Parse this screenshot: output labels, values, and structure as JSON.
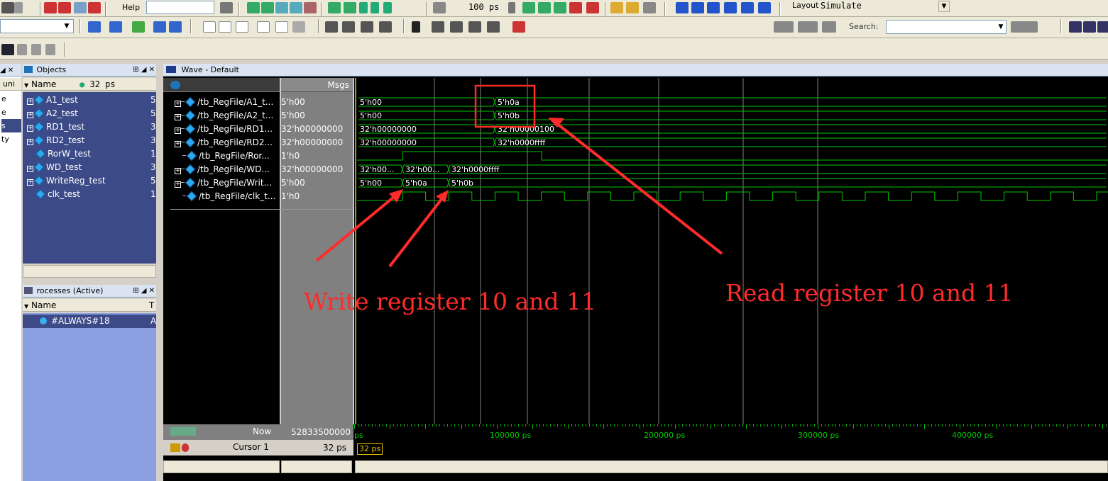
{
  "toolbar": {
    "help_label": "Help",
    "time_value": "100 ps",
    "layout_label": "Layout",
    "layout_value": "Simulate",
    "search_label": "Search:"
  },
  "objects_pane": {
    "title": "Objects",
    "col_name": "Name",
    "time_label": "32 ps",
    "items": [
      "A1_test",
      "A2_test",
      "RD1_test",
      "RD2_test",
      "RorW_test",
      "WD_test",
      "WriteReg_test",
      "clk_test"
    ],
    "right_col": [
      "5",
      "5",
      "3",
      "3",
      "1",
      "3",
      "5",
      "1"
    ]
  },
  "left_strip": {
    "header": "uni",
    "items": [
      "e",
      "e",
      "s",
      "ty"
    ]
  },
  "processes_pane": {
    "title": "rocesses (Active)",
    "col_name": "Name",
    "col_t": "T",
    "items": [
      "#ALWAYS#18"
    ],
    "right_col": [
      "A"
    ]
  },
  "wave": {
    "title": "Wave - Default",
    "msgs_header": "Msgs",
    "signals": [
      {
        "name": "/tb_RegFile/A1_t...",
        "value": "5'h00"
      },
      {
        "name": "/tb_RegFile/A2_t...",
        "value": "5'h00"
      },
      {
        "name": "/tb_RegFile/RD1...",
        "value": "32'h00000000"
      },
      {
        "name": "/tb_RegFile/RD2...",
        "value": "32'h00000000"
      },
      {
        "name": "/tb_RegFile/Ror...",
        "value": "1'h0"
      },
      {
        "name": "/tb_RegFile/WD...",
        "value": "32'h00000000"
      },
      {
        "name": "/tb_RegFile/Writ...",
        "value": "5'h00"
      },
      {
        "name": "/tb_RegFile/clk_t...",
        "value": "1'h0"
      }
    ],
    "bus_labels": {
      "a1_before": "5'h00",
      "a1_after": "5'h0a",
      "a2_before": "5'h00",
      "a2_after": "5'h0b",
      "rd1_before": "32'h00000000",
      "rd1_after": "32'h00000100",
      "rd2_before": "32'h00000000",
      "rd2_after": "32'h0000ffff",
      "wd_a": "32'h00...",
      "wd_b": "32'h00...",
      "wd_c": "32'h0000ffff",
      "wr_a": "5'h00",
      "wr_b": "5'h0a",
      "wr_c": "5'h0b"
    },
    "now_label": "Now",
    "now_value": "52833500000 ps",
    "cursor_label": "Cursor 1",
    "cursor_value": "32 ps",
    "cursor_tag": "32 ps",
    "ruler": [
      "ps",
      "100000 ps",
      "200000 ps",
      "300000 ps",
      "400000 ps"
    ]
  },
  "annotations": {
    "write_text": "Write register 10 and 11",
    "read_text": "Read register 10 and 11",
    "color": "#ff2b2b"
  },
  "colors": {
    "wave_bg": "#000000",
    "trace": "#00c800",
    "pane_blue": "#3c4a87"
  }
}
